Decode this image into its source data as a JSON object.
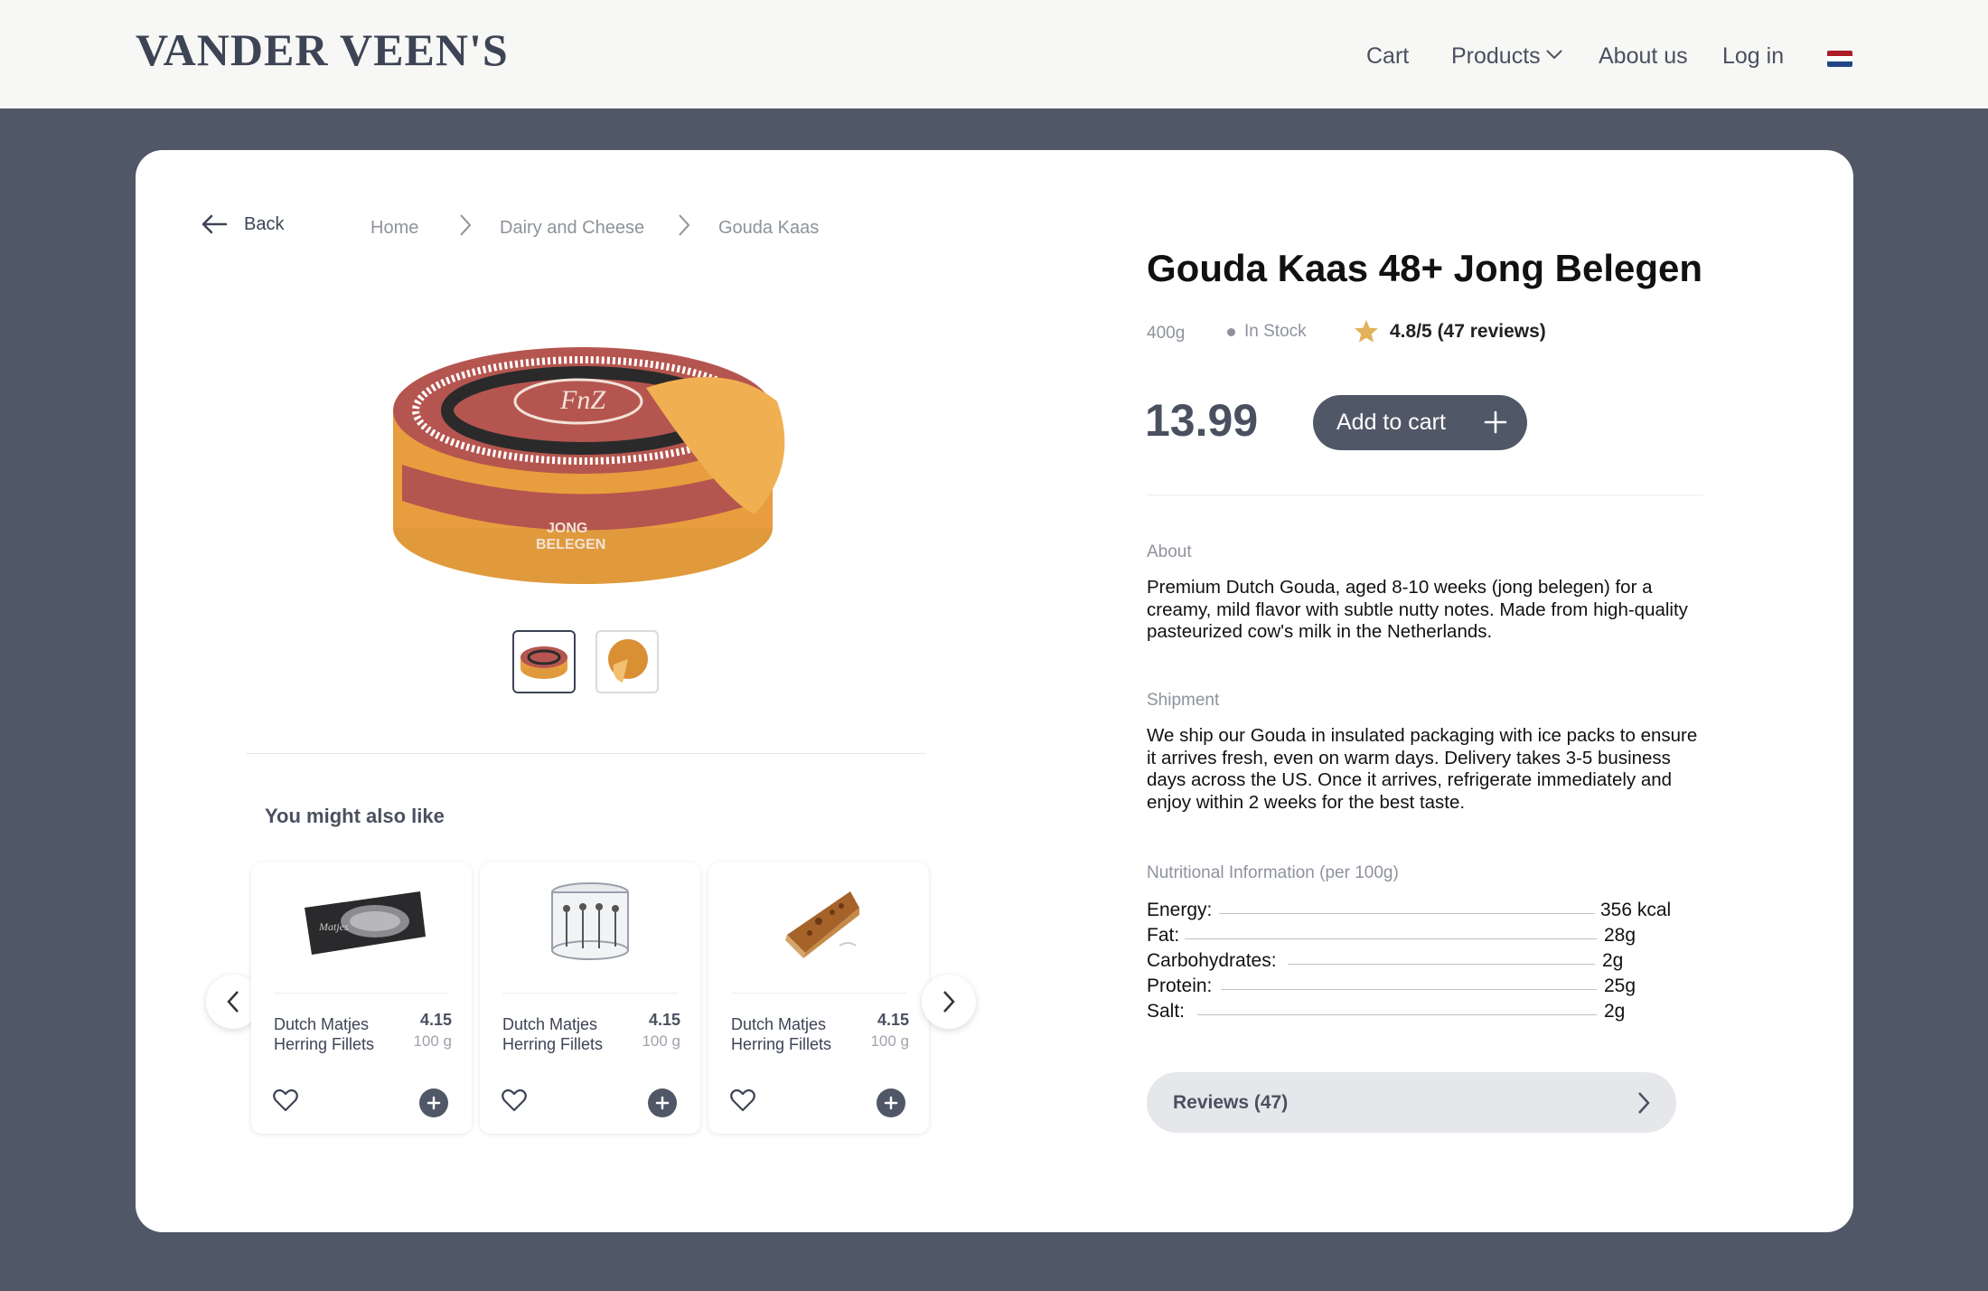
{
  "brand": {
    "logo_text": "VANDER VEEN'S"
  },
  "nav": {
    "cart": "Cart",
    "products": "Products",
    "about": "About us",
    "login": "Log in",
    "language_flag": "flag-nl-icon"
  },
  "colors": {
    "page_bg": "#505767",
    "header_bg": "#f7f7f5",
    "accent": "#505767",
    "star": "#e3b15a"
  },
  "back_label": "Back",
  "breadcrumb": [
    "Home",
    "Dairy and Cheese",
    "Gouda Kaas"
  ],
  "product": {
    "title": "Gouda Kaas 48+ Jong Belegen",
    "weight": "400g",
    "stock": "In Stock",
    "rating": "4.8/5",
    "reviews_text": "(47 reviews)",
    "price": "13.99",
    "add_to_cart": "Add to cart",
    "about_label": "About",
    "about_text": "Premium Dutch Gouda, aged 8-10 weeks (jong belegen) for a creamy, mild flavor with subtle nutty notes. Made from high-quality pasteurized cow's milk in the Netherlands.",
    "shipment_label": "Shipment",
    "shipment_text": "We ship our Gouda in insulated packaging with ice packs to ensure it arrives fresh, even on warm days. Delivery takes 3-5 business days across the US. Once it arrives, refrigerate immediately and enjoy within 2 weeks for the best taste.",
    "nutrition_label": "Nutritional Information (per 100g)",
    "nutrition": [
      {
        "key": "Energy:",
        "value": "356 kcal"
      },
      {
        "key": "Fat:",
        "value": "28g"
      },
      {
        "key": "Carbohydrates:",
        "value": "2g"
      },
      {
        "key": "Protein:",
        "value": "25g"
      },
      {
        "key": "Salt:",
        "value": "2g"
      }
    ],
    "reviews_button": "Reviews (47)",
    "gallery": [
      "gouda-wheel-image",
      "gouda-wedge-image"
    ]
  },
  "recommendations": {
    "title": "You might also like",
    "items": [
      {
        "name": "Dutch Matjes Herring Fillets",
        "price": "4.15",
        "weight": "100 g",
        "image": "herring-pack-image"
      },
      {
        "name": "Dutch Matjes Herring Fillets",
        "price": "4.15",
        "weight": "100 g",
        "image": "herring-tin-image"
      },
      {
        "name": "Dutch Matjes Herring Fillets",
        "price": "4.15",
        "weight": "100 g",
        "image": "pie-slice-image"
      }
    ]
  }
}
